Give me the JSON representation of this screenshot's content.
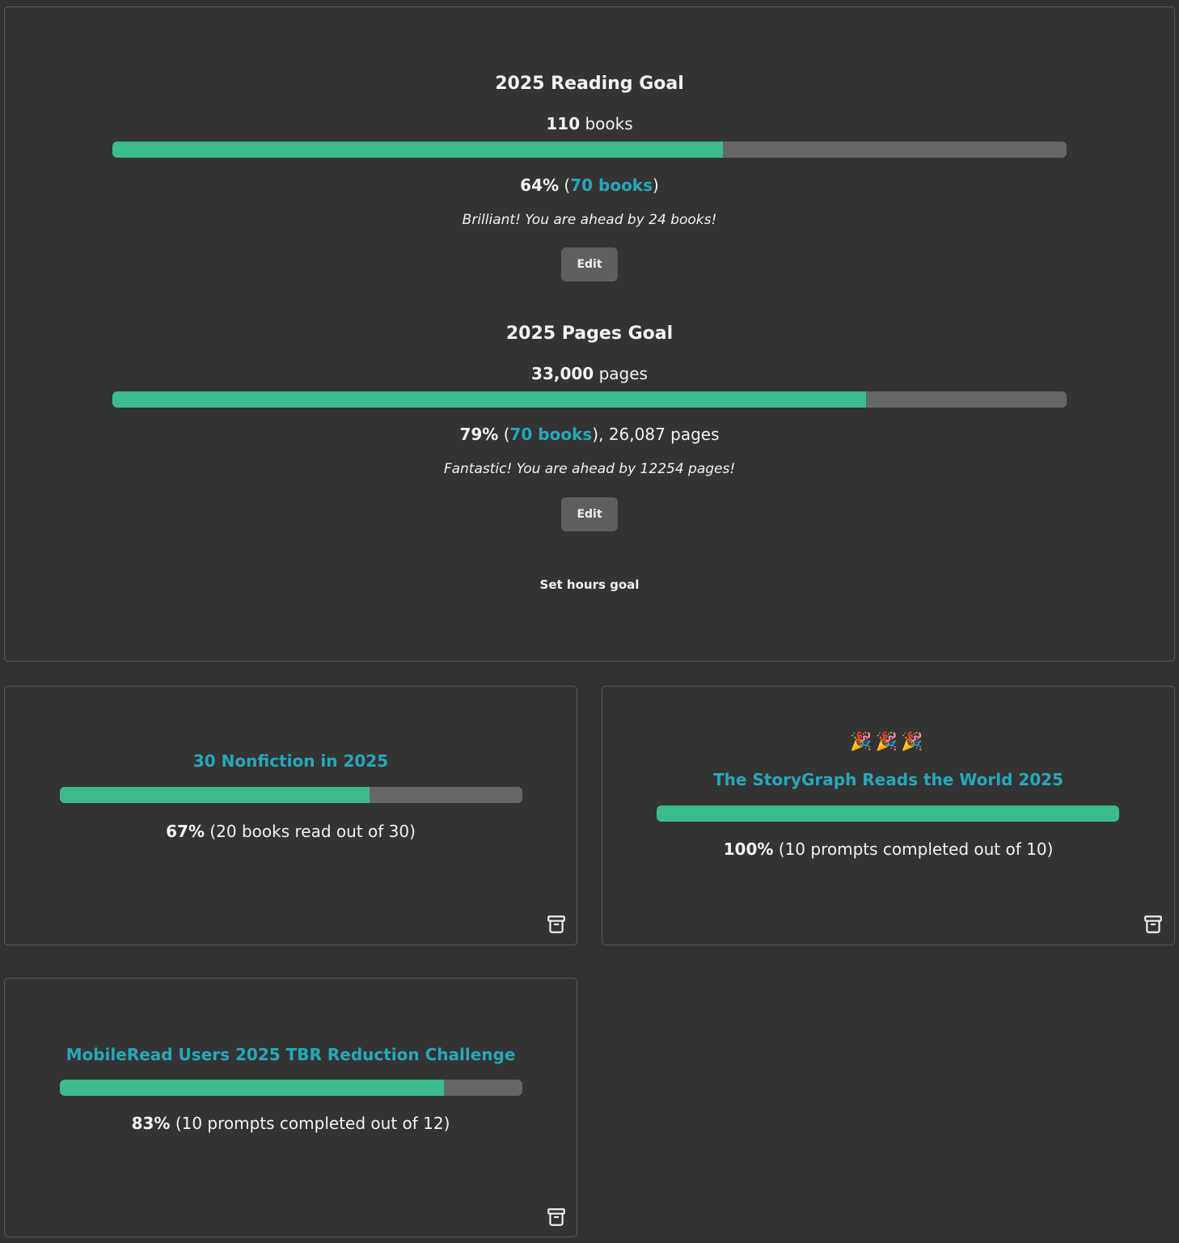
{
  "reading_goal": {
    "title": "2025 Reading Goal",
    "target_number": "110",
    "target_unit": "books",
    "progress_fraction": 0.64,
    "percent": "64%",
    "open_paren": "(",
    "books_link": "70 books",
    "close_paren": ")",
    "status": "Brilliant! You are ahead by 24 books!",
    "edit_label": "Edit"
  },
  "pages_goal": {
    "title": "2025 Pages Goal",
    "target_number": "33,000",
    "target_unit": "pages",
    "progress_fraction": 0.79,
    "percent": "79%",
    "open_paren": "(",
    "books_link": "70 books",
    "after_link": "), 26,087 pages",
    "status": "Fantastic! You are ahead by 12254 pages!",
    "edit_label": "Edit"
  },
  "hours_goal": {
    "label": "Set hours goal"
  },
  "challenges": [
    {
      "title": "30 Nonfiction in 2025",
      "progress_fraction": 0.67,
      "percent": "67%",
      "detail": "(20 books read out of 30)",
      "icon": "archive-icon"
    },
    {
      "title": "The StoryGraph Reads the World 2025",
      "celebration": "🎉🎉🎉",
      "progress_fraction": 1.0,
      "percent": "100%",
      "detail": "(10 prompts completed out of 10)",
      "icon": "archive-icon"
    },
    {
      "title": "MobileRead Users 2025 TBR Reduction Challenge",
      "progress_fraction": 0.83,
      "percent": "83%",
      "detail": "(10 prompts completed out of 12)",
      "icon": "archive-icon"
    }
  ],
  "colors": {
    "background": "#333333",
    "progress_fill": "#3cbb8d",
    "progress_track": "#666666",
    "link": "#26a8bb",
    "button": "#5f5f5f"
  }
}
